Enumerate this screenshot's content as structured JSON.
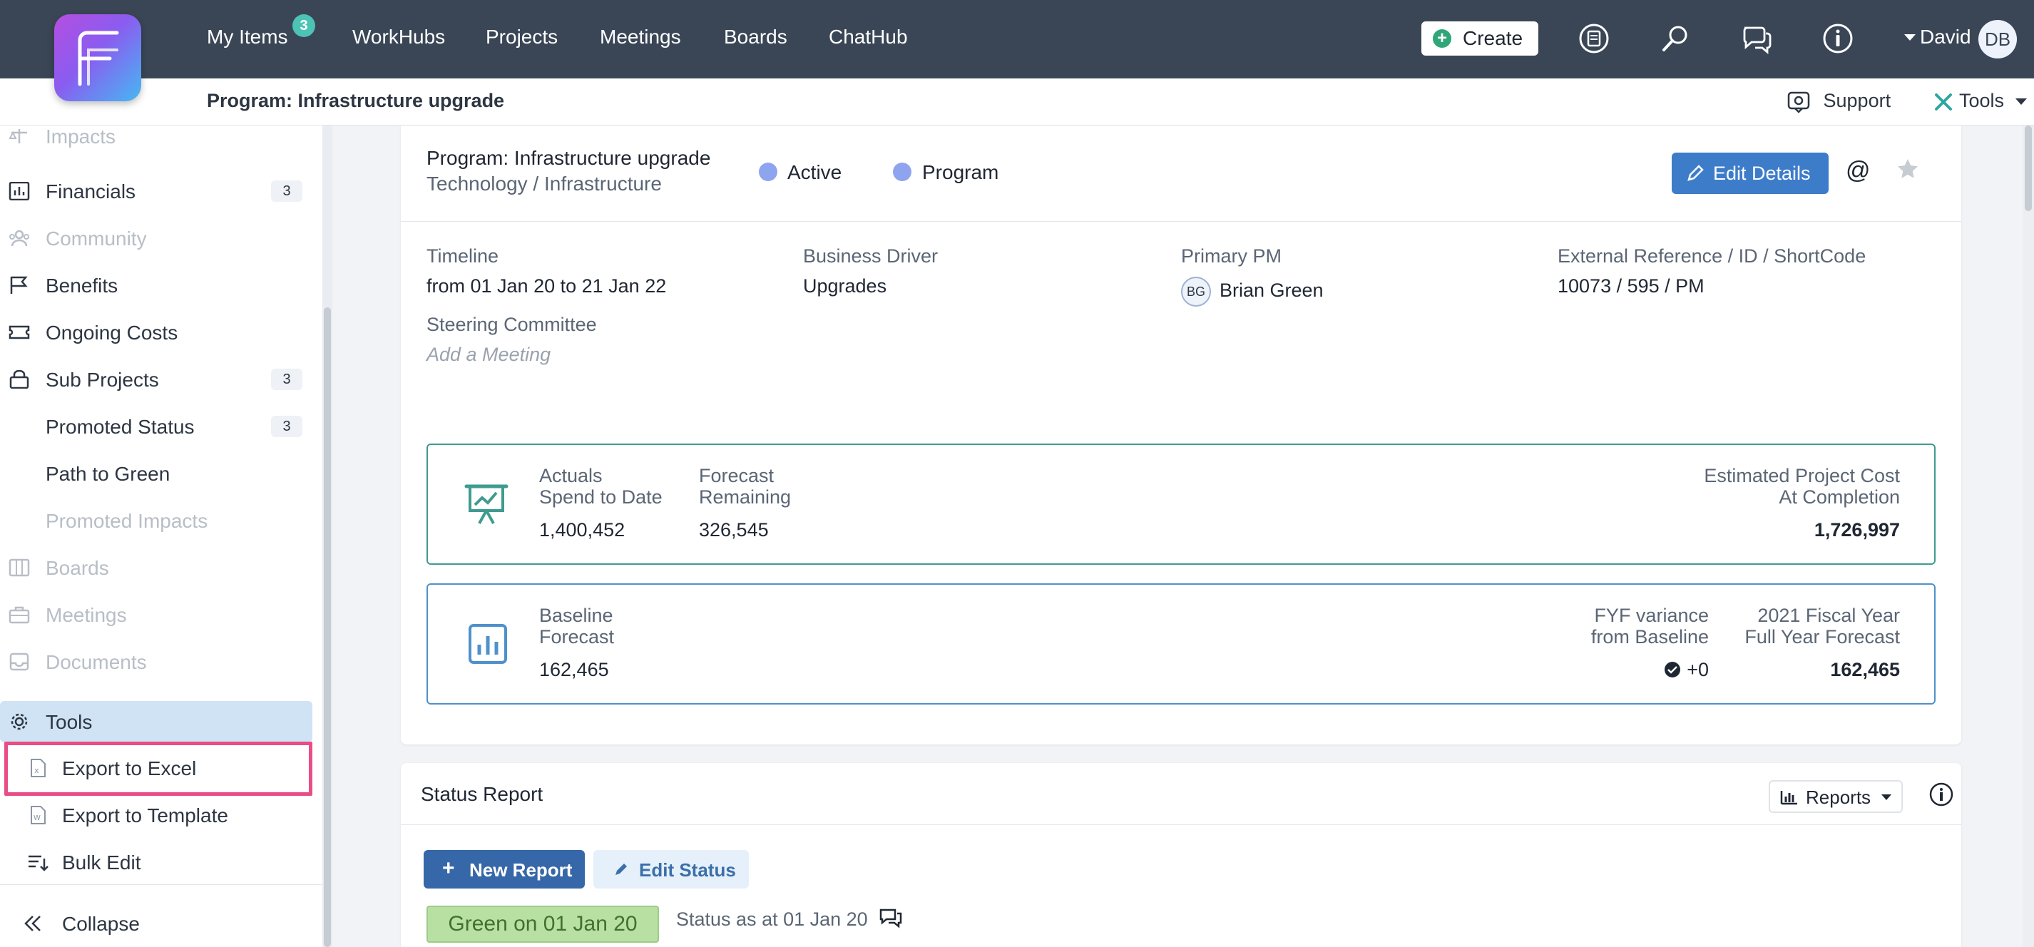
{
  "topnav": {
    "items": [
      {
        "label": "My Items",
        "badge": "3"
      },
      {
        "label": "WorkHubs"
      },
      {
        "label": "Projects"
      },
      {
        "label": "Meetings"
      },
      {
        "label": "Boards"
      },
      {
        "label": "ChatHub"
      }
    ],
    "create_label": "Create",
    "user_name": "David",
    "user_initials": "DB",
    "icons": [
      "reports-icon",
      "search-icon",
      "chat-icon",
      "info-icon"
    ]
  },
  "subheader": {
    "title": "Program: Infrastructure upgrade",
    "support_label": "Support",
    "tools_label": "Tools"
  },
  "sidebar": {
    "items": [
      {
        "label": "Impacts",
        "icon": "scale-icon",
        "state": "muted"
      },
      {
        "label": "Financials",
        "icon": "chart-icon",
        "count": "3",
        "state": "normal"
      },
      {
        "label": "Community",
        "icon": "people-icon",
        "state": "muted"
      },
      {
        "label": "Benefits",
        "icon": "flag-icon",
        "state": "normal"
      },
      {
        "label": "Ongoing Costs",
        "icon": "ticket-icon",
        "state": "normal"
      },
      {
        "label": "Sub Projects",
        "icon": "lock-icon",
        "count": "3",
        "state": "normal"
      },
      {
        "label": "Promoted Status",
        "count": "3",
        "state": "normal"
      },
      {
        "label": "Path to Green",
        "state": "normal"
      },
      {
        "label": "Promoted Impacts",
        "state": "muted"
      },
      {
        "label": "Boards",
        "icon": "board-icon",
        "state": "muted"
      },
      {
        "label": "Meetings",
        "icon": "briefcase-icon",
        "state": "muted"
      },
      {
        "label": "Documents",
        "icon": "inbox-icon",
        "state": "muted"
      },
      {
        "label": "Tools",
        "icon": "gear-icon",
        "state": "active"
      },
      {
        "label": "Export to Excel",
        "icon": "excel-file-icon",
        "state": "highlighted"
      },
      {
        "label": "Export to Template",
        "icon": "word-file-icon",
        "state": "normal"
      },
      {
        "label": "Bulk Edit",
        "icon": "bulk-edit-icon",
        "state": "normal"
      }
    ],
    "collapse_label": "Collapse"
  },
  "project": {
    "title": "Program: Infrastructure upgrade",
    "category": "Technology / Infrastructure",
    "status": "Active",
    "type": "Program",
    "edit_label": "Edit Details",
    "fields": {
      "timeline_label": "Timeline",
      "timeline_value": "from 01 Jan 20 to 21 Jan 22",
      "driver_label": "Business Driver",
      "driver_value": "Upgrades",
      "pm_label": "Primary PM",
      "pm_initials": "BG",
      "pm_value": "Brian Green",
      "ref_label": "External Reference / ID / ShortCode",
      "ref_value": "10073 / 595 / PM",
      "steering_label": "Steering Committee",
      "steering_placeholder": "Add a Meeting"
    }
  },
  "financials": {
    "actuals_label_1": "Actuals",
    "actuals_label_2": "Spend to Date",
    "actuals_value": "1,400,452",
    "forecast_label_1": "Forecast",
    "forecast_label_2": "Remaining",
    "forecast_value": "326,545",
    "eac_label_1": "Estimated Project Cost",
    "eac_label_2": "At Completion",
    "eac_value": "1,726,997",
    "baseline_label_1": "Baseline",
    "baseline_label_2": "Forecast",
    "baseline_value": "162,465",
    "fyf_label_1": "FYF variance",
    "fyf_label_2": "from Baseline",
    "fyf_value": "+0",
    "fy_label_1": "2021 Fiscal Year",
    "fy_label_2": "Full Year Forecast",
    "fy_value": "162,465"
  },
  "status_report": {
    "title": "Status Report",
    "reports_label": "Reports",
    "new_report_label": "New Report",
    "edit_status_label": "Edit Status",
    "status_chip": "Green on 01 Jan 20",
    "status_as_at": "Status as at 01 Jan 20"
  },
  "colors": {
    "nav_bg": "#3a4656",
    "accent_blue": "#3d7cc9",
    "green_border": "#3f9b8f",
    "highlight_pink": "#e94c86",
    "status_green": "#b8e0a3"
  }
}
